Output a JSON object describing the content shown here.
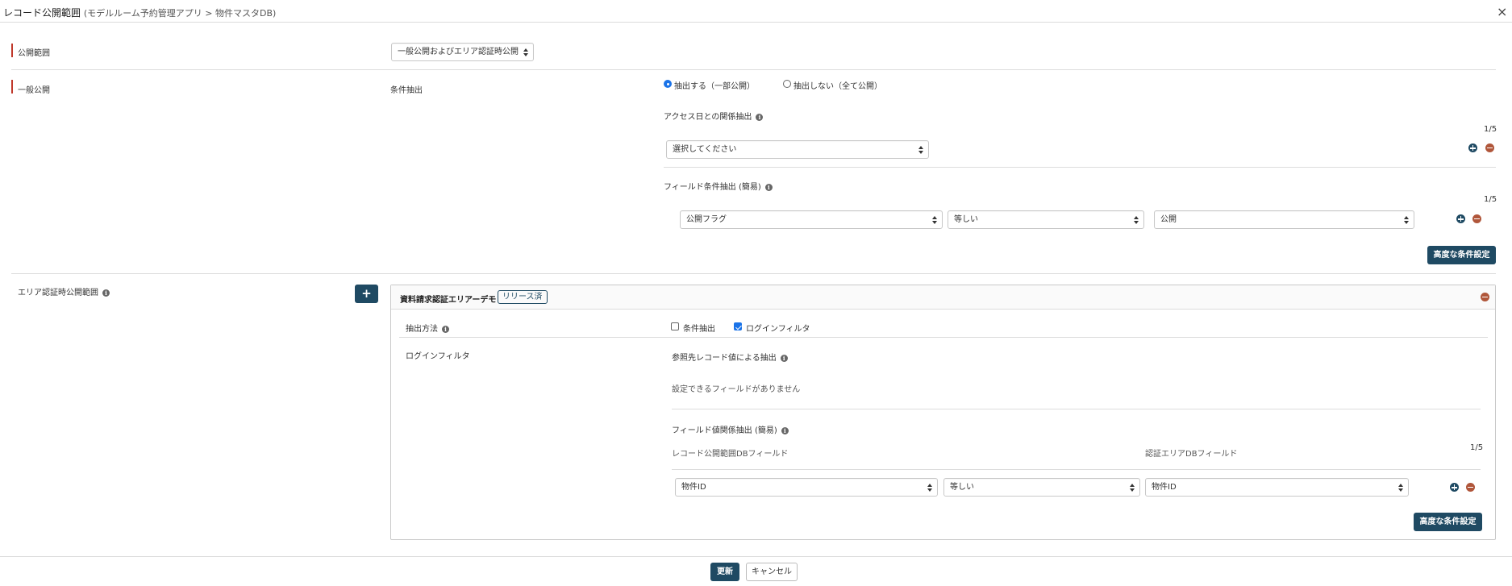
{
  "dialog": {
    "title": "レコード公開範囲",
    "subtitle": "(モデルルーム予約管理アプリ > 物件マスタDB)",
    "close_glyph": "×"
  },
  "scope": {
    "label": "公開範囲",
    "select_value": "一般公開およびエリア認証時公開"
  },
  "general": {
    "label": "一般公開",
    "condition_label": "条件抽出",
    "radio_extract": "抽出する（一部公開）",
    "radio_no_extract": "抽出しない（全て公開）",
    "access_date_title": "アクセス日との関係抽出",
    "access_count": "1/5",
    "access_select": "選択してください",
    "field_cond_title": "フィールド条件抽出 (簡易)",
    "field_count": "1/5",
    "field_select_1": "公開フラグ",
    "field_select_2": "等しい",
    "field_select_3": "公開",
    "advanced_button": "高度な条件設定"
  },
  "area": {
    "label": "エリア認証時公開範囲",
    "add_glyph": "+",
    "panel_title": "資料請求認証エリアーデモ",
    "badge": "リリース済",
    "method_label": "抽出方法",
    "check_condition": "条件抽出",
    "check_login": "ログインフィルタ",
    "login_filter_label": "ログインフィルタ",
    "ref_title": "参照先レコード値による抽出",
    "no_fields_text": "設定できるフィールドがありません",
    "field_rel_title": "フィールド値関係抽出 (簡易)",
    "col_left": "レコード公開範囲DBフィールド",
    "col_right": "認証エリアDBフィールド",
    "rel_count": "1/5",
    "rel_select_1": "物件ID",
    "rel_select_2": "等しい",
    "rel_select_3": "物件ID",
    "advanced_button": "高度な条件設定"
  },
  "footer": {
    "update_button": "更新",
    "cancel_button": "キャンセル"
  },
  "icons": {
    "info": "info-icon",
    "plus": "plus-circle-icon",
    "minus": "minus-circle-icon",
    "close": "close-icon"
  },
  "colors": {
    "primary": "#1f4a63",
    "danger": "#b0563a",
    "accent_bar": "#c0392b",
    "checked": "#1a73e8"
  }
}
